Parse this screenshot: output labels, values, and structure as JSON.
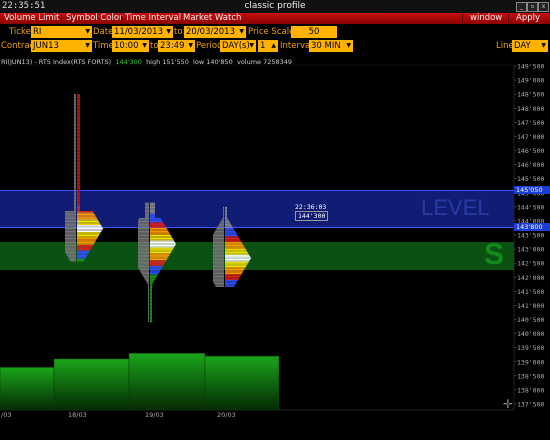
{
  "titlebar": {
    "clock": "22:35:51",
    "title": "classic profile",
    "min": "_",
    "restore": "▫",
    "close": "x"
  },
  "menubar": {
    "items": [
      "Volume Limit",
      "Symbol Color",
      "Time Interval",
      "Market Watch"
    ],
    "window": "window",
    "apply": "Apply"
  },
  "row1": {
    "ticker_label": "Ticker",
    "ticker": "RI",
    "date_label": "Date",
    "date_from": "11/03/2013",
    "to_label": "to",
    "date_to": "20/03/2013",
    "price_scale_label": "Price Scale",
    "price_scale": "50"
  },
  "row2": {
    "contract_label": "Contract",
    "contract": "JUN13",
    "time_label": "Time",
    "time_from": "10:00",
    "time_to_label": "to",
    "time_to": "23:49",
    "period_label": "Period",
    "period": "DAY(s)",
    "period_n": "1",
    "interval_label": "Interval",
    "interval": "30 MIN",
    "line_label": "Line",
    "line": "DAY"
  },
  "chart_info": {
    "symbol": "RI(JUN13) - RTS Index(RTS FORTS)",
    "last": "144'300",
    "high": "high 151'550",
    "low": "low 140'850",
    "volume": "volume 7258349"
  },
  "cursor": {
    "time": "22:36:03",
    "price": "144'300"
  },
  "zones": {
    "level_text": "LEVEL",
    "s_text": "S"
  },
  "price_tags": {
    "upper": "145'050",
    "lower": "143'800"
  },
  "colors": {
    "level_zone": "#14228a",
    "s_zone": "#0c5a14",
    "menu": "#c81010",
    "field": "#ffb300",
    "label": "#f0a000"
  },
  "chart_data": {
    "type": "bar",
    "y_axis_labels": [
      "149'500",
      "149'000",
      "148'500",
      "148'000",
      "147'500",
      "147'000",
      "146'500",
      "146'000",
      "145'500",
      "145'000",
      "144'500",
      "144'000",
      "143'500",
      "143'000",
      "142'500",
      "142'000",
      "141'500",
      "141'000",
      "140'500",
      "140'000",
      "139'500",
      "139'000",
      "138'500",
      "138'000",
      "137'500"
    ],
    "ylim": [
      137500,
      149500
    ],
    "x_labels": [
      "/03",
      "18/03",
      "19/03",
      "20/03"
    ],
    "days": [
      {
        "label": "15/03",
        "profile_low": 142900,
        "profile_high": 148600,
        "poc": 143900,
        "volume_level": 138800
      },
      {
        "label": "18/03",
        "profile_low": 142600,
        "profile_high": 148500,
        "poc": 143750,
        "volume_level": 139100
      },
      {
        "label": "19/03",
        "profile_low": 140450,
        "profile_high": 144650,
        "poc": 143200,
        "volume_level": 139300
      },
      {
        "label": "20/03",
        "profile_low": 141700,
        "profile_high": 144500,
        "poc": 142700,
        "volume_level": 139200
      }
    ]
  }
}
